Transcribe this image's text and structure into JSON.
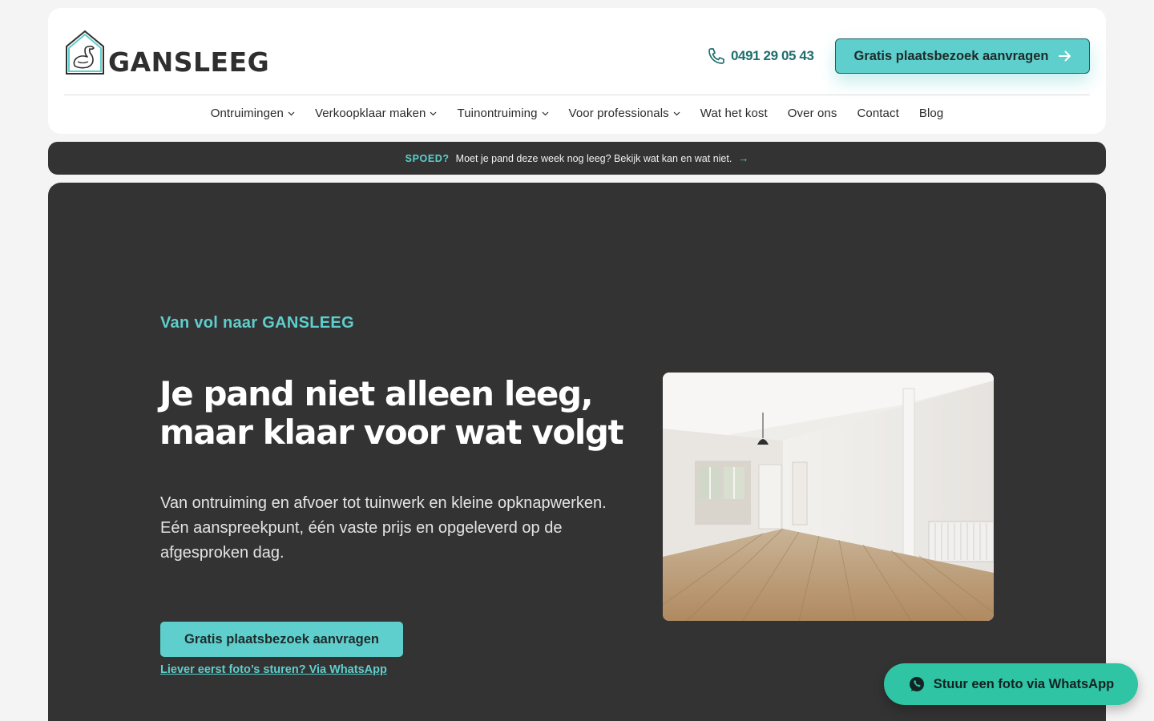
{
  "brand": {
    "name": "GANSLEEG",
    "accent": "#5ecfcc",
    "dark": "#333333",
    "logo_icon": "goose-house-icon"
  },
  "header": {
    "phone": "0491 29 05 43",
    "cta_label": "Gratis plaatsbezoek aanvragen"
  },
  "nav": {
    "items": [
      {
        "label": "Ontruimingen"
      },
      {
        "label": "Verkoopklaar maken"
      },
      {
        "label": "Tuinontruiming"
      },
      {
        "label": "Voor professionals"
      },
      {
        "label": "Wat het kost"
      },
      {
        "label": "Over ons"
      },
      {
        "label": "Contact"
      },
      {
        "label": "Blog"
      }
    ]
  },
  "banner": {
    "tag": "SPOED?",
    "text": "Moet je pand deze week nog leeg? Bekijk wat kan en wat niet.",
    "arrow": "→"
  },
  "hero": {
    "eyebrow": "Van vol naar GANSLEEG",
    "title_line1": "Je pand niet alleen leeg,",
    "title_line2": "maar klaar voor wat volgt",
    "text": "Van ontruiming en afvoer tot tuinwerk en kleine opknapwerken. Eén aanspreekpunt, één vaste prijs en opgeleverd op de afgesproken dag.",
    "cta_label": "Gratis plaatsbezoek aanvragen",
    "whatsapp_link": "Liever eerst foto’s sturen? Via WhatsApp"
  },
  "floating": {
    "whatsapp_label": "Stuur een foto via WhatsApp",
    "color": "#2ec4a4"
  }
}
